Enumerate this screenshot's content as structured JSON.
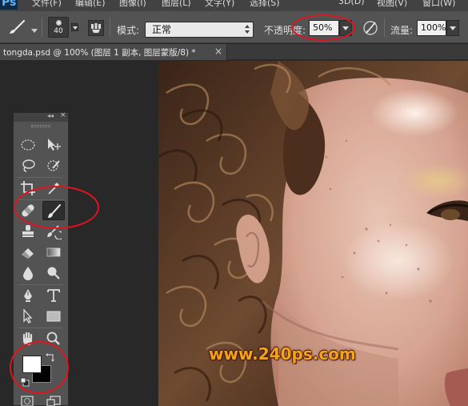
{
  "menubar": {
    "logo": "Ps",
    "items": [
      "文件(F)",
      "编辑(E)",
      "图像(I)",
      "图层(L)",
      "文字(Y)",
      "选择(S)",
      "3D(D)",
      "视图(V)",
      "窗口(W)"
    ]
  },
  "options_bar": {
    "tool_icon": "brush-icon",
    "brush_size": "40",
    "mode_label": "模式:",
    "mode_value": "正常",
    "opacity_label": "不透明度:",
    "opacity_value": "50%",
    "flow_label": "流量:",
    "flow_value": "100%"
  },
  "document": {
    "tab_title": "tongda.psd @ 100% (图层 1 副本, 图层蒙版/8) *",
    "close_glyph": "×"
  },
  "tools_panel": {
    "collapse_glyph": "◂◂",
    "close_glyph": "×",
    "tools": [
      "marquee-tool",
      "move-tool",
      "lasso-tool",
      "quick-selection-tool",
      "crop-tool",
      "eyedropper-tool",
      "healing-brush-tool",
      "brush-tool",
      "clone-stamp-tool",
      "history-brush-tool",
      "eraser-tool",
      "gradient-tool",
      "blur-tool",
      "dodge-tool",
      "pen-tool",
      "type-tool",
      "path-selection-tool",
      "rectangle-tool",
      "hand-tool",
      "zoom-tool"
    ],
    "active_tool": "brush-tool",
    "foreground_color": "#ffffff",
    "background_color": "#000000"
  },
  "canvas": {
    "watermark": "www.240ps.com"
  },
  "colors": {
    "annotation": "#e0141e",
    "watermark": "#f5a31c",
    "panel": "#535353",
    "workspace": "#282828"
  }
}
